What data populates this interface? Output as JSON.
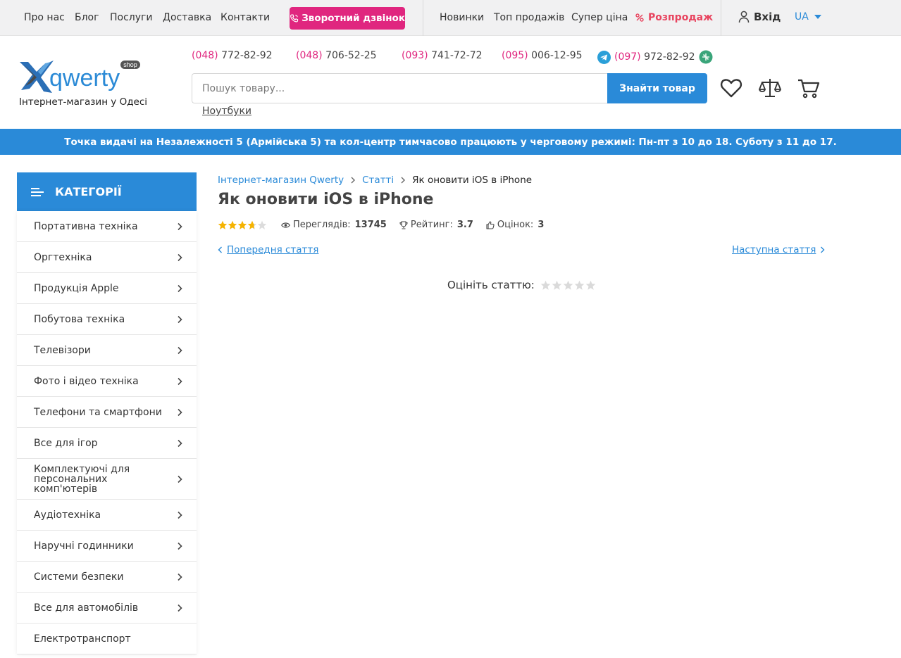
{
  "topbar": {
    "links_left": [
      "Про нас",
      "Блог",
      "Послуги",
      "Доставка",
      "Контакти"
    ],
    "callback_label": "Зворотний дзвінок",
    "links_right": [
      "Новинки",
      "Топ продажів",
      "Супер ціна"
    ],
    "sale_label": "Розпродаж",
    "login_label": "Вхід",
    "lang_label": "UA"
  },
  "header": {
    "logo_text": "qwerty",
    "logo_badge": "shop",
    "logo_subtitle": "Інтернет-магазин у Одесі",
    "phones": [
      {
        "code": "(048)",
        "number": " 772-82-92"
      },
      {
        "code": "(048)",
        "number": " 706-52-25"
      },
      {
        "code": "(093)",
        "number": " 741-72-72"
      },
      {
        "code": "(095)",
        "number": " 006-12-95"
      },
      {
        "code": "(097)",
        "number": " 972-82-92"
      }
    ],
    "search_placeholder": "Пошук товару...",
    "search_button": "Знайти товар",
    "search_hint": "Ноутбуки",
    "icons": [
      "heart-icon",
      "compare-scales-icon",
      "cart-icon"
    ]
  },
  "notice": "Точка видачі на Незалежності 5 (Армійська 5) та кол-центр тимчасово працюють у черговому режимі: Пн-пт з 10 до 18. Суботу з 11 до 17.",
  "sidebar": {
    "title": "КАТЕГОРІЇ",
    "items": [
      "Портативна техніка",
      "Оргтехніка",
      "Продукція Apple",
      "Побутова техніка",
      "Телевізори",
      "Фото і відео техніка",
      "Телефони та смартфони",
      "Все для ігор",
      "Комплектуючі для персональних комп'ютерів",
      "Аудіотехніка",
      "Наручні годинники",
      "Системи безпеки",
      "Все для автомобілів",
      "Електротранспорт"
    ]
  },
  "article": {
    "breadcrumbs": [
      "Інтернет-магазин Qwerty",
      "Статті",
      "Як оновити iOS в iPhone"
    ],
    "title": "Як оновити iOS в iPhone",
    "rating_stars": 3.7,
    "views_label": "Переглядів:",
    "views": "13745",
    "rating_label": "Рейтинг:",
    "rating": "3.7",
    "votes_label": "Оцінок:",
    "votes": "3",
    "prev_label": "Попередня стаття",
    "next_label": "Наступна стаття",
    "rate_label": "Оцініть статтю:"
  },
  "colors": {
    "accent": "#2a8ad8",
    "callback": "#e0267f",
    "sale": "#e8445f",
    "star": "#f5b301"
  }
}
